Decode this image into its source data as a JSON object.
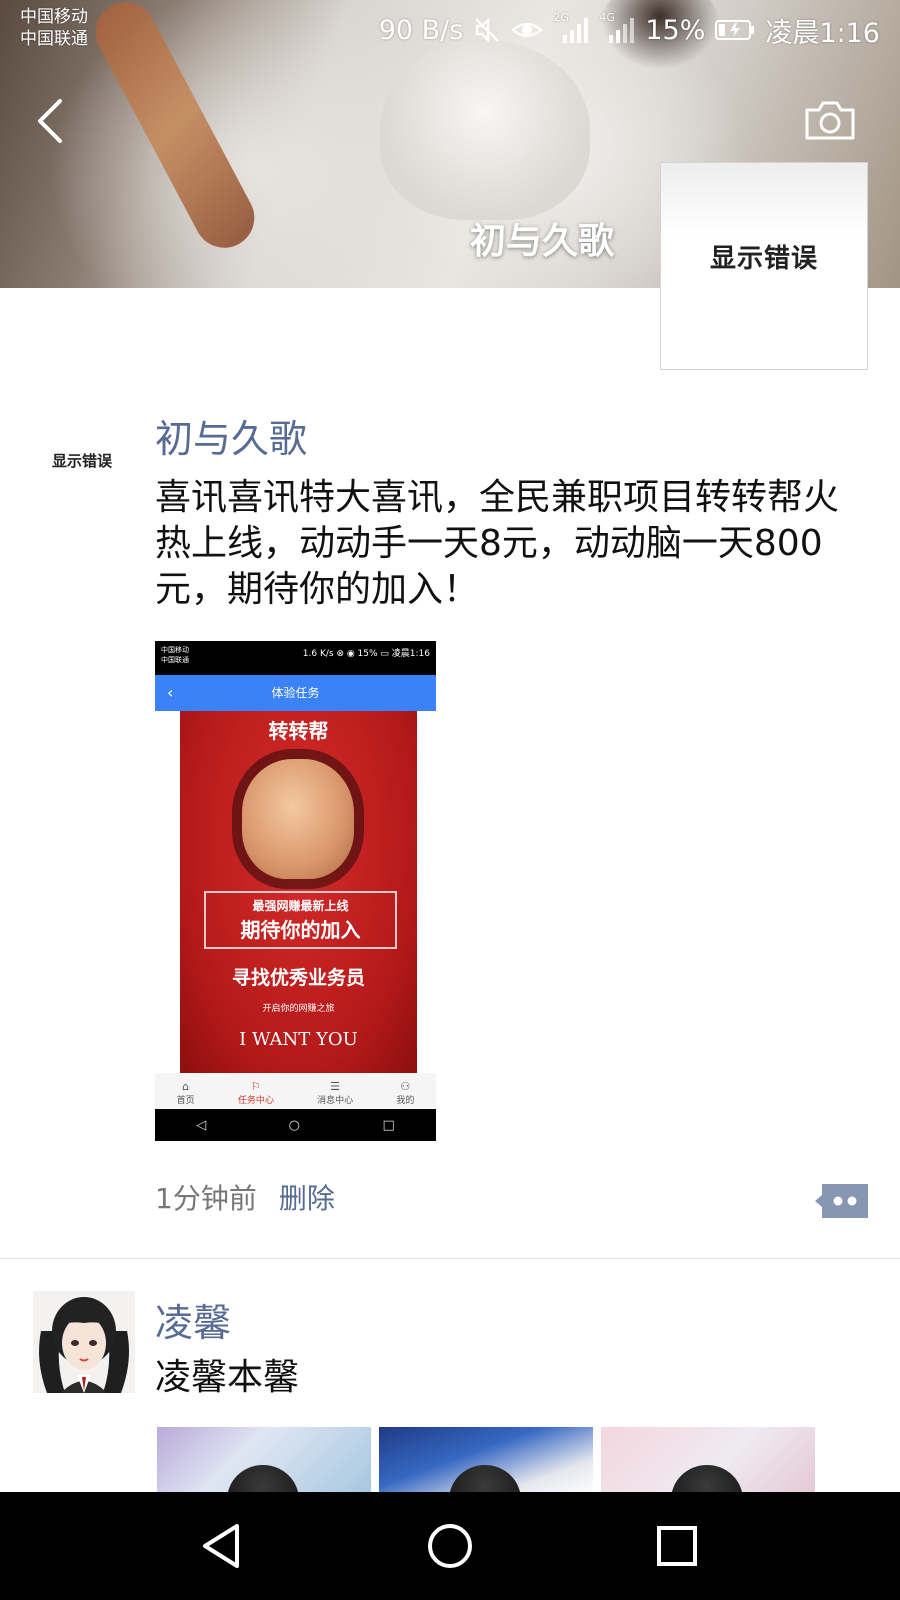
{
  "status_bar": {
    "carrier_1": "中国移动",
    "carrier_2": "中国联通",
    "speed": "90 B/s",
    "network_2g": "2G",
    "network_4g": "4G",
    "battery": "15%",
    "time": "凌晨1:16"
  },
  "cover": {
    "name": "初与久歌",
    "avatar_error": "显示错误"
  },
  "posts": [
    {
      "avatar_error": "显示错误",
      "username": "初与久歌",
      "text": "喜讯喜讯特大喜讯，全民兼职项目转转帮火热上线，动动手一天8元，动动脑一天800元，期待你的加入！",
      "time": "1分钟前",
      "delete_label": "删除",
      "image": {
        "status_left": "中国移动\n中国联通",
        "status_right": "1.6 K/s ⊗ ◉ 15% ▭ 凌晨1:16",
        "header_title": "体验任务",
        "poster_title": "转转帮",
        "poster_box_line1": "最强网赚最新上线",
        "poster_box_line2": "期待你的加入",
        "poster_seek": "寻找优秀业务员",
        "poster_seek_sub": "开启你的网赚之旅",
        "poster_want": "I WANT YOU",
        "tabs": [
          {
            "icon": "⌂",
            "label": "首页"
          },
          {
            "icon": "⚐",
            "label": "任务中心"
          },
          {
            "icon": "☰",
            "label": "消息中心"
          },
          {
            "icon": "⚇",
            "label": "我的"
          }
        ],
        "nav": [
          "◁",
          "○",
          "□"
        ]
      }
    },
    {
      "username": "凌馨",
      "text": "凌馨本馨"
    }
  ],
  "colors": {
    "link": "#576b95",
    "time_gray": "#777777",
    "phone_header_blue": "#3b82f6",
    "poster_red": "#b31919"
  },
  "icons": [
    "back-icon",
    "camera-icon",
    "comment-icon",
    "mute-icon",
    "eye-icon",
    "signal-icon",
    "battery-icon",
    "nav-back-icon",
    "nav-home-icon",
    "nav-recent-icon"
  ]
}
